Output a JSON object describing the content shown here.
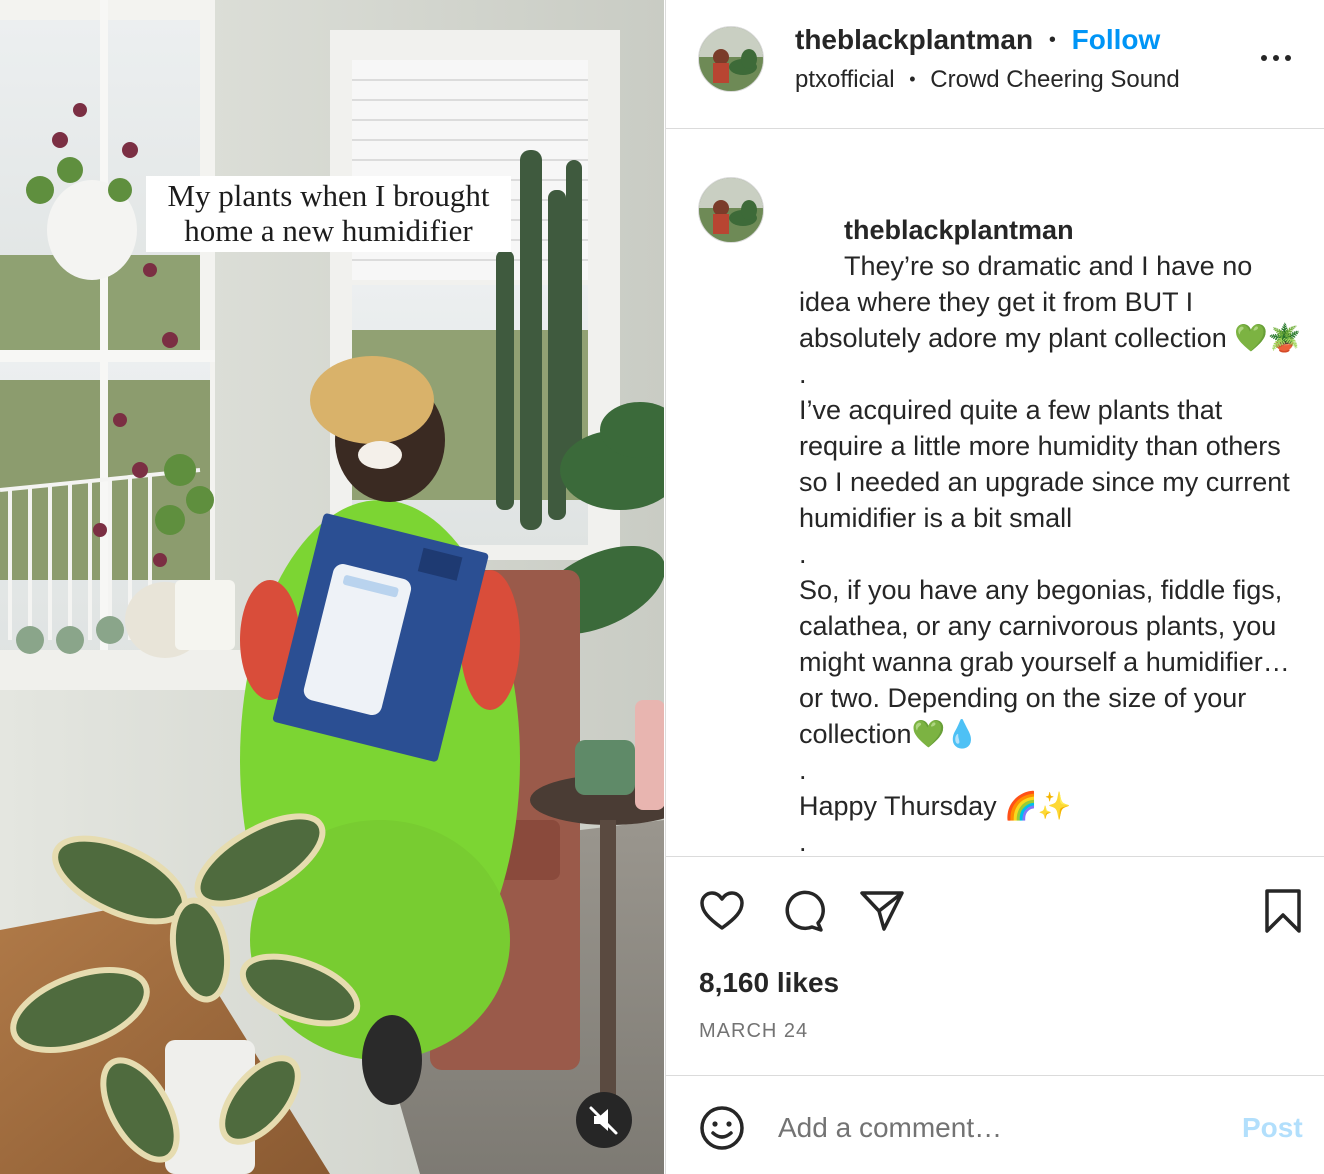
{
  "media": {
    "overlay_caption_line1": "My plants when I brought",
    "overlay_caption_line2": "home a new humidifier",
    "mute_icon": "speaker-muted-icon"
  },
  "header": {
    "username": "theblackplantman",
    "dot": "•",
    "follow_label": "Follow",
    "audio_artist": "ptxofficial",
    "audio_sep": "•",
    "audio_title": "Crowd Cheering Sound",
    "more_icon": "more-horizontal-icon"
  },
  "caption": {
    "username": "theblackplantman",
    "text": "They’re so dramatic and I have no idea where they get it from BUT I absolutely adore my plant collection 💚🪴\n.\nI’ve acquired quite a few plants that require a little more humidity than others so I needed an upgrade since my current humidifier is a bit small\n.\nSo, if you have any begonias, fiddle figs, calathea, or any carnivorous plants, you might wanna grab yourself a humidifier…or two. Depending on the size of your collection💚💧\n.\nHappy Thursday 🌈✨\n."
  },
  "actions": {
    "like_icon": "heart-icon",
    "comment_icon": "comment-icon",
    "share_icon": "paper-plane-icon",
    "save_icon": "bookmark-icon"
  },
  "stats": {
    "likes": "8,160 likes",
    "date": "MARCH 24"
  },
  "comment_box": {
    "emoji_icon": "smiley-icon",
    "placeholder": "Add a comment…",
    "post_label": "Post"
  },
  "colors": {
    "link_blue": "#0095f6",
    "post_disabled": "#b2dffc",
    "text": "#262626",
    "muted": "#737373",
    "border": "#dbdbdb"
  }
}
